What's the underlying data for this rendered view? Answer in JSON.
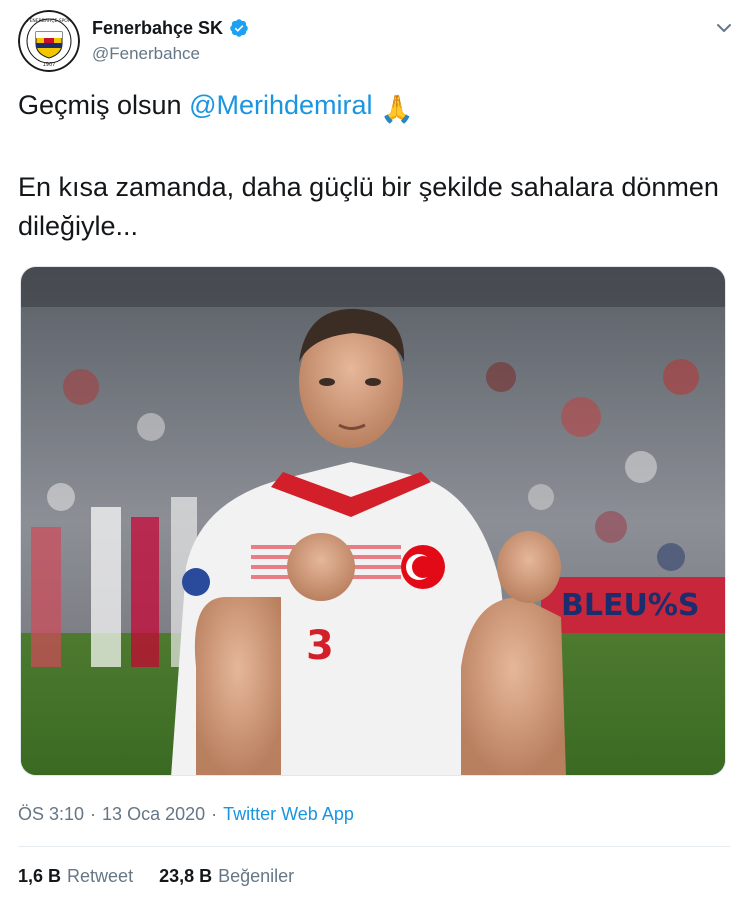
{
  "header": {
    "display_name": "Fenerbahçe SK",
    "handle": "@Fenerbahce",
    "avatar_icon": "fenerbahce-crest-icon",
    "verified_icon": "verified-badge-icon",
    "menu_icon": "chevron-down-icon"
  },
  "tweet": {
    "line1_prefix": "Geçmiş olsun ",
    "mention": "@Merihdemiral",
    "emoji": "🙏",
    "line2": "En kısa zamanda, daha güçlü bir şekilde sahalara dönmen dileğiyle..."
  },
  "photo": {
    "jersey_number": "3",
    "banner_text": "BLEU%S"
  },
  "meta": {
    "time": "ÖS 3:10",
    "separator1": "·",
    "date": "13 Oca 2020",
    "separator2": "·",
    "source": "Twitter Web App"
  },
  "stats": {
    "retweets_count": "1,6 B",
    "retweets_label": "Retweet",
    "likes_count": "23,8 B",
    "likes_label": "Beğeniler"
  },
  "colors": {
    "link": "#1b95e0",
    "secondary": "#657786",
    "text": "#14171a",
    "verified": "#1da1f2"
  }
}
